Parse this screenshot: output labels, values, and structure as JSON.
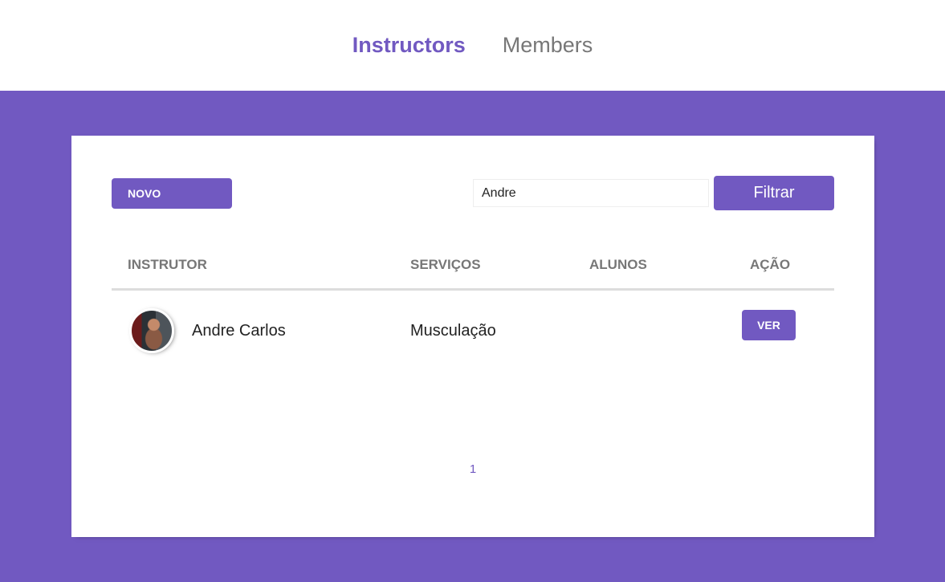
{
  "nav": {
    "items": [
      {
        "label": "Instructors",
        "active": true
      },
      {
        "label": "Members",
        "active": false
      }
    ]
  },
  "toolbar": {
    "new_label": "Novo",
    "search_value": "Andre",
    "filter_label": "Filtrar"
  },
  "table": {
    "headers": [
      "Instrutor",
      "Serviços",
      "Alunos",
      "Ação"
    ],
    "rows": [
      {
        "name": "Andre Carlos",
        "services": "Musculação",
        "students": "",
        "action_label": "Ver"
      }
    ]
  },
  "pagination": {
    "pages": [
      "1"
    ]
  },
  "colors": {
    "accent": "#7159c1",
    "header_text": "#777777"
  }
}
